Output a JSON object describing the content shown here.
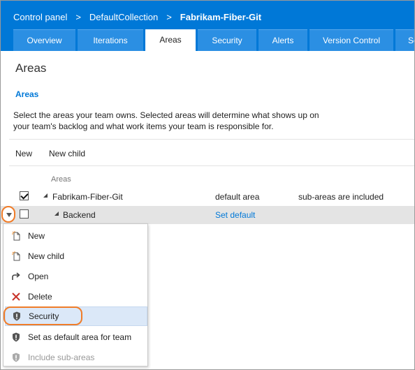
{
  "breadcrumb": {
    "items": [
      "Control panel",
      "DefaultCollection",
      "Fabrikam-Fiber-Git"
    ],
    "separator": ">"
  },
  "tabs": [
    {
      "label": "Overview",
      "active": false
    },
    {
      "label": "Iterations",
      "active": false
    },
    {
      "label": "Areas",
      "active": true
    },
    {
      "label": "Security",
      "active": false
    },
    {
      "label": "Alerts",
      "active": false
    },
    {
      "label": "Version Control",
      "active": false
    },
    {
      "label": "Se",
      "active": false
    }
  ],
  "page": {
    "title": "Areas",
    "section_heading": "Areas",
    "description_line1": "Select the areas your team owns. Selected areas will determine what shows up on",
    "description_line2": "your team's backlog and what work items your team is responsible for."
  },
  "toolbar": {
    "new_label": "New",
    "new_child_label": "New child"
  },
  "tree": {
    "column_header": "Areas",
    "rows": [
      {
        "name": "Fabrikam-Fiber-Git",
        "checked": true,
        "default": "default area",
        "subareas": "sub-areas are included"
      },
      {
        "name": "Backend",
        "checked": false,
        "default": "Set default",
        "subareas": ""
      }
    ]
  },
  "context_menu": {
    "items": [
      {
        "label": "New",
        "icon": "new-item-icon",
        "disabled": false
      },
      {
        "label": "New child",
        "icon": "new-child-icon",
        "disabled": false
      },
      {
        "label": "Open",
        "icon": "open-arrow-icon",
        "disabled": false
      },
      {
        "label": "Delete",
        "icon": "delete-x-icon",
        "disabled": false
      },
      {
        "label": "Security",
        "icon": "shield-icon",
        "disabled": false
      },
      {
        "label": "Set as default area for team",
        "icon": "shield-icon",
        "disabled": false
      },
      {
        "label": "Include sub-areas",
        "icon": "shield-icon",
        "disabled": true
      }
    ]
  },
  "colors": {
    "header_blue": "#0078d7",
    "tab_blue": "#2b8fe3",
    "highlight_orange": "#f07c28",
    "delete_red": "#c8332a",
    "link_blue": "#0078d7"
  }
}
